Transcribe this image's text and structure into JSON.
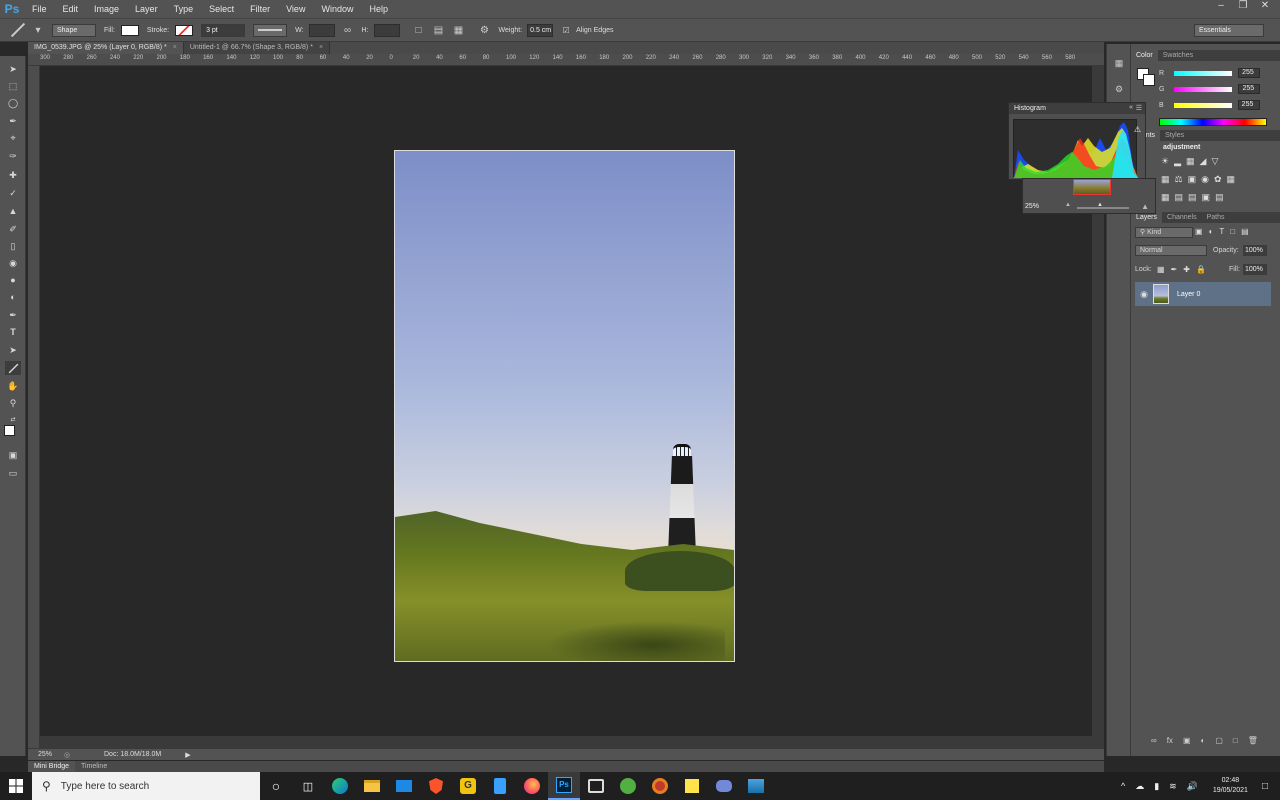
{
  "app": {
    "logo": "Ps"
  },
  "menu": [
    "File",
    "Edit",
    "Image",
    "Layer",
    "Type",
    "Select",
    "Filter",
    "View",
    "Window",
    "Help"
  ],
  "options": {
    "tool_mode": "Shape",
    "fill_label": "Fill:",
    "stroke_label": "Stroke:",
    "stroke_width": "3 pt",
    "w_label": "W:",
    "h_label": "H:",
    "weight_label": "Weight:",
    "weight_value": "0.5 cm",
    "align_edges_label": "Align Edges",
    "align_edges_checked": true,
    "workspace": "Essentials"
  },
  "tabs": [
    {
      "label": "IMG_0539.JPG @ 25% (Layer 0, RGB/8) *",
      "active": true
    },
    {
      "label": "Untitled-1 @ 66.7% (Shape 3, RGB/8) *",
      "active": false
    }
  ],
  "ruler_h": [
    "300",
    "280",
    "260",
    "240",
    "220",
    "200",
    "180",
    "160",
    "140",
    "120",
    "100",
    "80",
    "60",
    "40",
    "20",
    "0",
    "20",
    "40",
    "60",
    "80",
    "100",
    "120",
    "140",
    "160",
    "180",
    "200",
    "220",
    "240",
    "260",
    "280",
    "300",
    "320",
    "340",
    "360",
    "380",
    "400",
    "420",
    "440",
    "460",
    "480",
    "500",
    "520",
    "540",
    "560",
    "580"
  ],
  "status": {
    "zoom": "25%",
    "doc": "Doc: 18.0M/18.0M"
  },
  "bottom_tabs": [
    "Mini Bridge",
    "Timeline"
  ],
  "color_panel": {
    "tabs": [
      "Color",
      "Swatches"
    ],
    "channels": [
      {
        "label": "R",
        "value": "255"
      },
      {
        "label": "G",
        "value": "255"
      },
      {
        "label": "B",
        "value": "255"
      }
    ]
  },
  "adjustments_panel": {
    "tabs": [
      "ments",
      "Styles"
    ],
    "title": "adjustment"
  },
  "histogram": {
    "title": "Histogram"
  },
  "navigator": {
    "zoom": "25%"
  },
  "layers_panel": {
    "tabs": [
      "Layers",
      "Channels",
      "Paths"
    ],
    "filter_kind": "Kind",
    "blend_mode": "Normal",
    "opacity_label": "Opacity:",
    "opacity_value": "100%",
    "lock_label": "Lock:",
    "fill_label": "Fill:",
    "fill_value": "100%",
    "layers": [
      {
        "name": "Layer 0",
        "visible": true
      }
    ]
  },
  "taskbar": {
    "search_placeholder": "Type here to search",
    "time": "02:48",
    "date": "19/05/2021"
  },
  "colors": {
    "accent_blue": "#3fa9f5",
    "layer_selected": "#5f7186"
  }
}
